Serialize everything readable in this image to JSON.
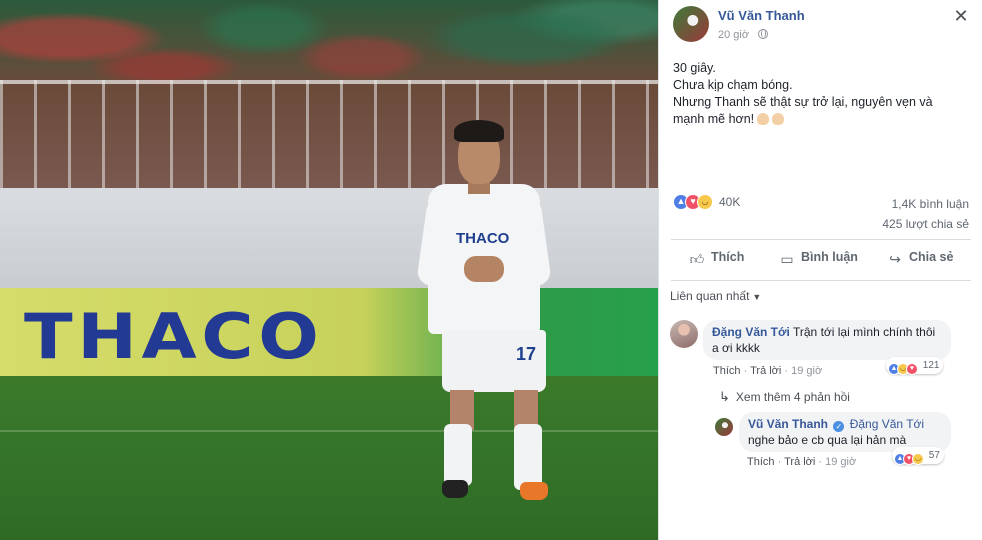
{
  "post": {
    "author": "Vũ Văn Thanh",
    "time": "20 giờ",
    "text_lines": [
      "30 giây.",
      "Chưa kịp chạm bóng.",
      "Nhưng Thanh sẽ thật sự trở lại, nguyên vẹn và",
      "mạnh mẽ hơn!"
    ],
    "reaction_count": "40K",
    "comments_count": "1,4K bình luận",
    "shares_count": "425 lượt chia sẻ"
  },
  "photo": {
    "banner_text": "THACO",
    "shirt_sponsor": "THACO",
    "shirt_number": "17"
  },
  "actions": {
    "like": "Thích",
    "comment": "Bình luận",
    "share": "Chia sẻ"
  },
  "sort_label": "Liên quan nhất",
  "comments": [
    {
      "author": "Đặng Văn Tới",
      "text": "Trận tới lại mình chính thôi a ơi kkkk",
      "like": "Thích",
      "reply": "Trả lời",
      "time": "19 giờ",
      "reactions": "121"
    }
  ],
  "more_replies": "Xem thêm 4 phản hồi",
  "reply": {
    "author": "Vũ Văn Thanh",
    "tag": "Đặng Văn Tới",
    "text": "nghe bảo e cb qua lại hản mà",
    "like": "Thích",
    "reply": "Trả lời",
    "time": "19 giờ",
    "reactions": "57"
  },
  "icons": {
    "close": "close-icon",
    "globe": "globe-icon",
    "like": "thumbs-up-icon",
    "comment": "speech-bubble-icon",
    "share": "share-arrow-icon"
  },
  "colors": {
    "link": "#365899",
    "like_reaction": "#4f7fe6",
    "love_reaction": "#f25268",
    "haha_reaction": "#f7c84a",
    "verified": "#4a90e2"
  }
}
